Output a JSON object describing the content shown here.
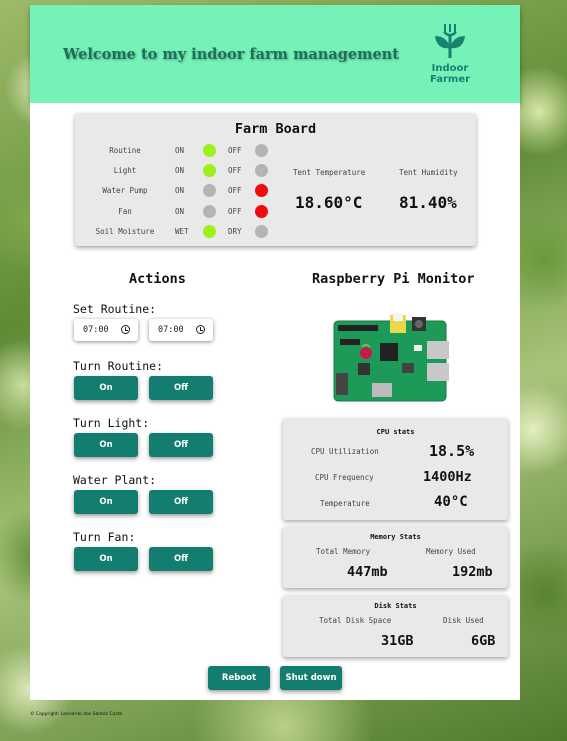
{
  "header": {
    "title": "Welcome to my indoor farm management",
    "logo_line1": "Indoor",
    "logo_line2": "Farmer"
  },
  "farm_board": {
    "title": "Farm Board",
    "rows": [
      {
        "label": "Routine",
        "on_label": "ON",
        "off_label": "OFF",
        "state": "on"
      },
      {
        "label": "Light",
        "on_label": "ON",
        "off_label": "OFF",
        "state": "on"
      },
      {
        "label": "Water Pump",
        "on_label": "ON",
        "off_label": "OFF",
        "state": "off"
      },
      {
        "label": "Fan",
        "on_label": "ON",
        "off_label": "OFF",
        "state": "off"
      },
      {
        "label": "Soil Moisture",
        "on_label": "WET",
        "off_label": "DRY",
        "state": "on"
      }
    ],
    "tent_temperature_label": "Tent Temperature",
    "tent_temperature_value": "18.60°C",
    "tent_humidity_label": "Tent Humidity",
    "tent_humidity_value": "81.40%"
  },
  "actions": {
    "title": "Actions",
    "set_routine_label": "Set Routine:",
    "routine_start": "07:00",
    "routine_end": "07:00",
    "groups": [
      {
        "label": "Turn Routine:",
        "on": "On",
        "off": "Off"
      },
      {
        "label": "Turn Light:",
        "on": "On",
        "off": "Off"
      },
      {
        "label": "Water Plant:",
        "on": "On",
        "off": "Off"
      },
      {
        "label": "Turn Fan:",
        "on": "On",
        "off": "Off"
      }
    ]
  },
  "monitor": {
    "title": "Raspberry Pi Monitor",
    "cpu": {
      "title": "CPU stats",
      "utilization_label": "CPU Utilization",
      "utilization_value": "18.5%",
      "frequency_label": "CPU Frequency",
      "frequency_value": "1400Hz",
      "temperature_label": "Temperature",
      "temperature_value": "40°C"
    },
    "memory": {
      "title": "Memory Stats",
      "total_label": "Total Memory",
      "total_value": "447mb",
      "used_label": "Memory Used",
      "used_value": "192mb"
    },
    "disk": {
      "title": "Disk Stats",
      "total_label": "Total Disk Space",
      "total_value": "31GB",
      "used_label": "Disk Used",
      "used_value": "6GB"
    }
  },
  "system": {
    "reboot": "Reboot",
    "shutdown": "Shut down"
  },
  "footer": {
    "copyright": "©   Copyright: Leonardo dos Santos Costa"
  },
  "colors": {
    "header_bg": "#74f2b7",
    "button_bg": "#137d70",
    "indicator_on": "#9ef01a",
    "indicator_off": "#f00c0c",
    "indicator_idle": "#b4b4b4"
  }
}
